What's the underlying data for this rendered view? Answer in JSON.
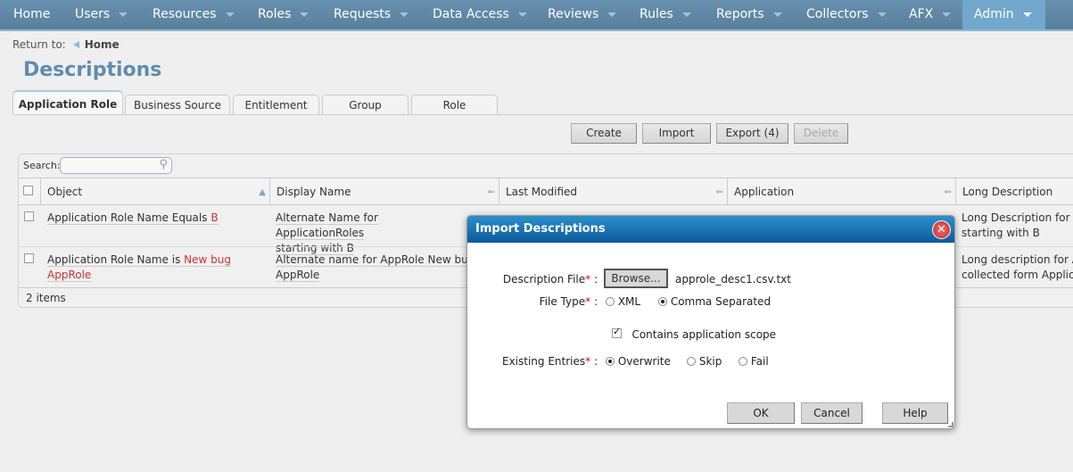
{
  "nav": {
    "items": [
      {
        "label": "Home",
        "caret": false
      },
      {
        "label": "Users",
        "caret": true
      },
      {
        "label": "Resources",
        "caret": true
      },
      {
        "label": "Roles",
        "caret": true
      },
      {
        "label": "Requests",
        "caret": true
      },
      {
        "label": "Data Access",
        "caret": true
      },
      {
        "label": "Reviews",
        "caret": true
      },
      {
        "label": "Rules",
        "caret": true
      },
      {
        "label": "Reports",
        "caret": true
      },
      {
        "label": "Collectors",
        "caret": true
      },
      {
        "label": "AFX",
        "caret": true
      },
      {
        "label": "Admin",
        "caret": true,
        "active": true
      }
    ]
  },
  "breadcrumb": {
    "prefix": "Return to:",
    "link": "Home"
  },
  "page_title": "Descriptions",
  "tabs": [
    {
      "label": "Application Role",
      "active": true
    },
    {
      "label": "Business Source"
    },
    {
      "label": "Entitlement"
    },
    {
      "label": "Group"
    },
    {
      "label": "Role"
    }
  ],
  "toolbar": {
    "create": "Create",
    "import": "Import",
    "export": "Export (4)",
    "delete": "Delete"
  },
  "search": {
    "label": "Search:",
    "value": ""
  },
  "table": {
    "columns": [
      "Object",
      "Display Name",
      "Last Modified",
      "Application",
      "Long Description"
    ],
    "rows": [
      {
        "object_prefix": "Application Role Name Equals ",
        "object_value": "B",
        "display_name_1": "Alternate Name for ApplicationRoles",
        "display_name_2": "starting with B",
        "long_desc_1": "Long Description for A",
        "long_desc_2": "starting with B"
      },
      {
        "object_prefix": "Application Role Name is ",
        "object_value": "New bug",
        "object_value_2": "AppRole",
        "display_name_1": "Alternate name for AppRole New bu",
        "display_name_2": "AppRole",
        "long_desc_1": "Long description for A",
        "long_desc_2": "collected form Applica"
      }
    ],
    "footer": "2 items"
  },
  "dialog": {
    "title": "Import Descriptions",
    "description_file_label": "Description File",
    "browse": "Browse...",
    "file_name": "approle_desc1.csv.txt",
    "file_type_label": "File Type",
    "file_type_options": [
      "XML",
      "Comma Separated"
    ],
    "file_type_selected": "Comma Separated",
    "scope_label": "Contains application scope",
    "scope_checked": true,
    "existing_label": "Existing Entries",
    "existing_options": [
      "Overwrite",
      "Skip",
      "Fail"
    ],
    "existing_selected": "Overwrite",
    "required_mark": "*",
    "colon": ":",
    "ok": "OK",
    "cancel": "Cancel",
    "help": "Help"
  }
}
